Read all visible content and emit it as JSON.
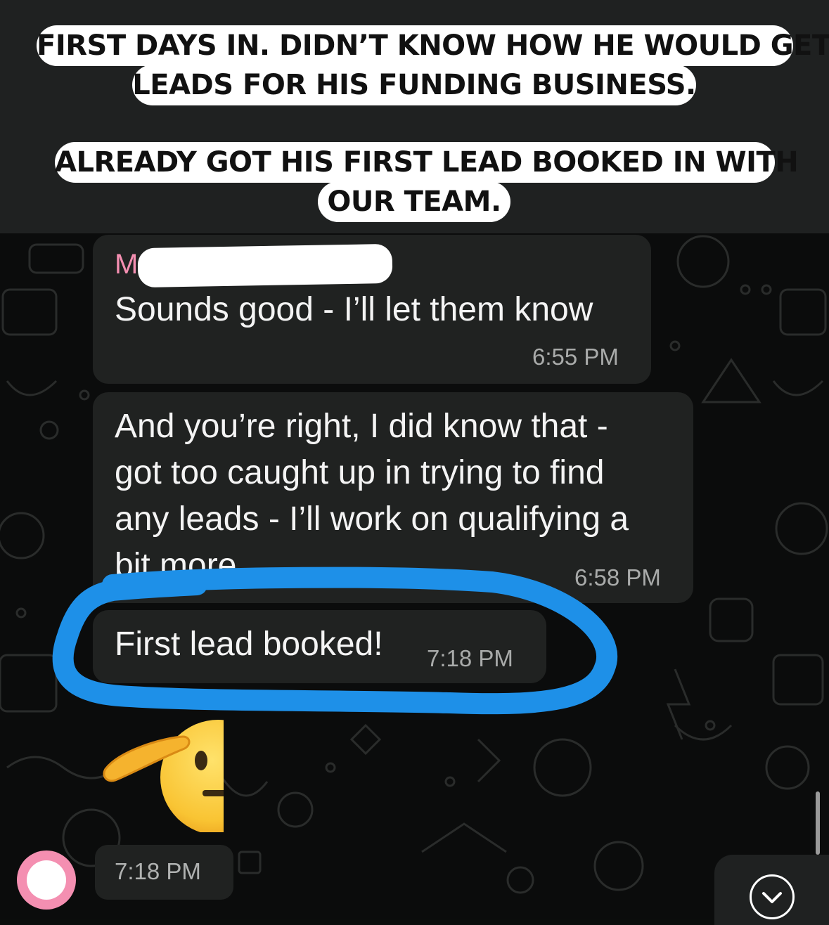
{
  "caption": {
    "lines": [
      "FIRST DAYS IN. DIDN’T KNOW HOW HE WOULD GET",
      "LEADS FOR HIS FUNDING BUSINESS.",
      "ALREADY GOT HIS FIRST LEAD BOOKED IN WITH",
      "OUR TEAM."
    ]
  },
  "chat": {
    "sender_initial": "M",
    "messages": [
      {
        "text": "Sounds good - I’ll let them know",
        "time": "6:55 PM"
      },
      {
        "text": "And you’re right, I did know that -\ngot too caught up in trying to find\nany leads - I’ll work on qualifying a\nbit more",
        "time": "6:58 PM"
      },
      {
        "text": "First lead booked!",
        "time": "7:18 PM"
      }
    ],
    "emoji_message": {
      "emoji": "saluting-face",
      "time": "7:18 PM"
    }
  },
  "colors": {
    "bubble": "#202221",
    "sender_name": "#f48fb1",
    "annotation_circle": "#1e90e8",
    "background": "#0b0c0c"
  },
  "icons": [
    "chevron-down-icon",
    "saluting-face-emoji",
    "avatar"
  ]
}
